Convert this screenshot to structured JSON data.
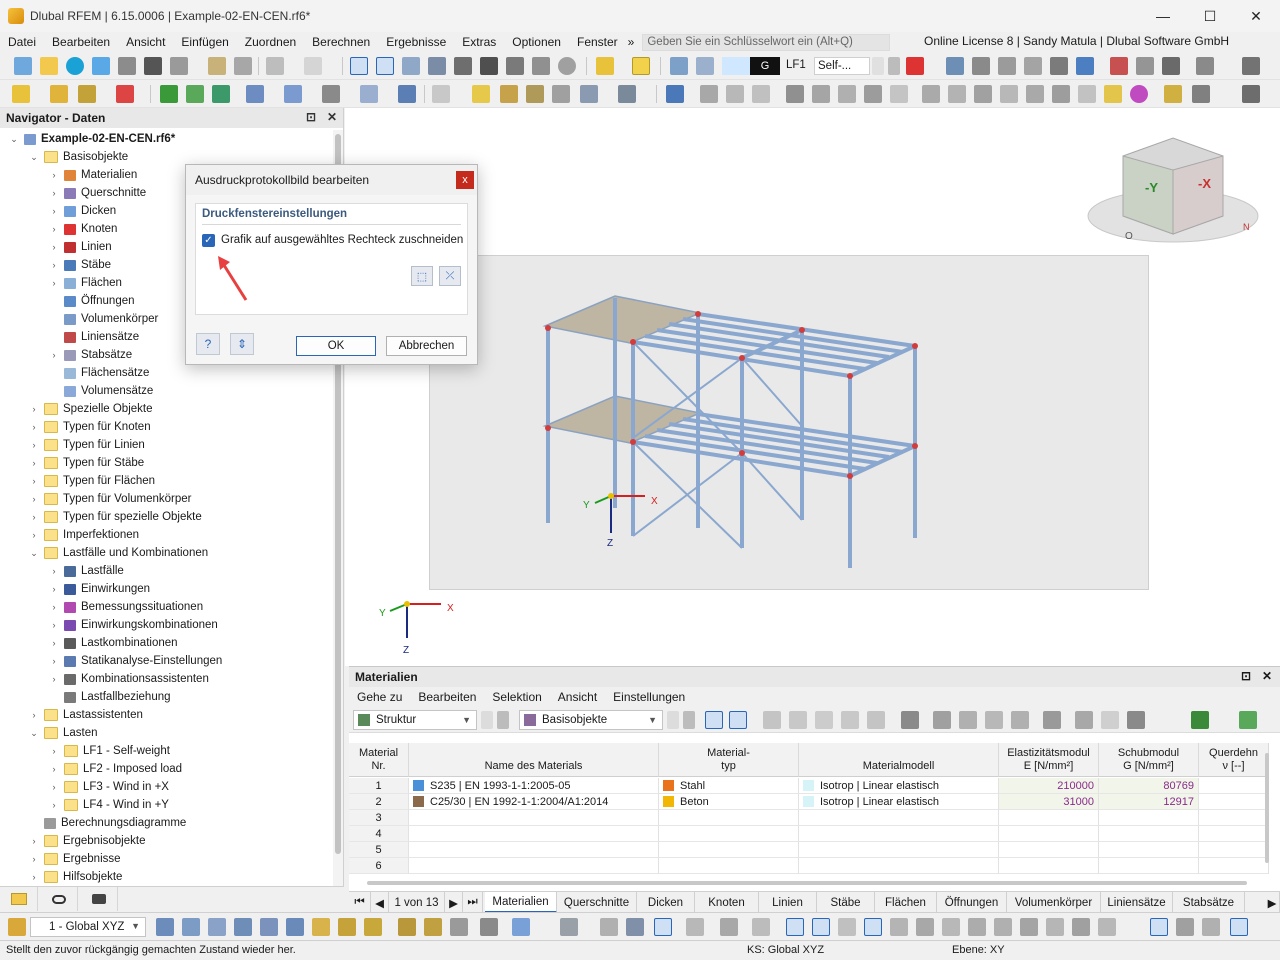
{
  "window": {
    "title": "Dlubal RFEM | 6.15.0006 | Example-02-EN-CEN.rf6*",
    "minimize": "—",
    "maximize": "☐",
    "close": "✕"
  },
  "menu": {
    "items": [
      "Datei",
      "Bearbeiten",
      "Ansicht",
      "Einfügen",
      "Zuordnen",
      "Berechnen",
      "Ergebnisse",
      "Extras",
      "Optionen",
      "Fenster"
    ],
    "overflow": "»",
    "search_placeholder": "Geben Sie ein Schlüsselwort ein (Alt+Q)",
    "license": "Online License 8 | Sandy Matula | Dlubal Software GmbH"
  },
  "toolbar": {
    "load_case_code": "G",
    "load_case": "LF1",
    "load_case_name": "Self-..."
  },
  "navigator": {
    "title": "Navigator - Daten",
    "pin": "⊡",
    "close": "✕",
    "items": [
      {
        "label": "Example-02-EN-CEN.rf6*",
        "level": 0,
        "state": "open",
        "icon": "model-icon"
      },
      {
        "label": "Basisobjekte",
        "level": 1,
        "state": "open",
        "icon": "folder-icon"
      },
      {
        "label": "Materialien",
        "level": 2,
        "state": "closed",
        "icon": "materials-icon"
      },
      {
        "label": "Querschnitte",
        "level": 2,
        "state": "closed",
        "icon": "cross-section-icon"
      },
      {
        "label": "Dicken",
        "level": 2,
        "state": "closed",
        "icon": "thickness-icon"
      },
      {
        "label": "Knoten",
        "level": 2,
        "state": "closed",
        "icon": "node-icon"
      },
      {
        "label": "Linien",
        "level": 2,
        "state": "closed",
        "icon": "line-icon"
      },
      {
        "label": "Stäbe",
        "level": 2,
        "state": "closed",
        "icon": "member-icon"
      },
      {
        "label": "Flächen",
        "level": 2,
        "state": "closed",
        "icon": "surface-icon"
      },
      {
        "label": "Öffnungen",
        "level": 2,
        "state": "none",
        "icon": "opening-icon"
      },
      {
        "label": "Volumenkörper",
        "level": 2,
        "state": "none",
        "icon": "solid-icon"
      },
      {
        "label": "Liniensätze",
        "level": 2,
        "state": "none",
        "icon": "line-set-icon"
      },
      {
        "label": "Stabsätze",
        "level": 2,
        "state": "closed",
        "icon": "member-set-icon"
      },
      {
        "label": "Flächensätze",
        "level": 2,
        "state": "none",
        "icon": "surface-set-icon"
      },
      {
        "label": "Volumensätze",
        "level": 2,
        "state": "none",
        "icon": "solid-set-icon"
      },
      {
        "label": "Spezielle Objekte",
        "level": 1,
        "state": "closed",
        "icon": "folder-icon"
      },
      {
        "label": "Typen für Knoten",
        "level": 1,
        "state": "closed",
        "icon": "folder-icon"
      },
      {
        "label": "Typen für Linien",
        "level": 1,
        "state": "closed",
        "icon": "folder-icon"
      },
      {
        "label": "Typen für Stäbe",
        "level": 1,
        "state": "closed",
        "icon": "folder-icon"
      },
      {
        "label": "Typen für Flächen",
        "level": 1,
        "state": "closed",
        "icon": "folder-icon"
      },
      {
        "label": "Typen für Volumenkörper",
        "level": 1,
        "state": "closed",
        "icon": "folder-icon"
      },
      {
        "label": "Typen für spezielle Objekte",
        "level": 1,
        "state": "closed",
        "icon": "folder-icon"
      },
      {
        "label": "Imperfektionen",
        "level": 1,
        "state": "closed",
        "icon": "folder-icon"
      },
      {
        "label": "Lastfälle und Kombinationen",
        "level": 1,
        "state": "open",
        "icon": "folder-icon"
      },
      {
        "label": "Lastfälle",
        "level": 2,
        "state": "closed",
        "icon": "load-case-icon"
      },
      {
        "label": "Einwirkungen",
        "level": 2,
        "state": "closed",
        "icon": "action-icon"
      },
      {
        "label": "Bemessungssituationen",
        "level": 2,
        "state": "closed",
        "icon": "design-situation-icon"
      },
      {
        "label": "Einwirkungskombinationen",
        "level": 2,
        "state": "closed",
        "icon": "action-combination-icon"
      },
      {
        "label": "Lastkombinationen",
        "level": 2,
        "state": "closed",
        "icon": "load-combination-icon"
      },
      {
        "label": "Statikanalyse-Einstellungen",
        "level": 2,
        "state": "closed",
        "icon": "analysis-settings-icon"
      },
      {
        "label": "Kombinationsassistenten",
        "level": 2,
        "state": "closed",
        "icon": "combination-wizard-icon"
      },
      {
        "label": "Lastfallbeziehung",
        "level": 2,
        "state": "none",
        "icon": "relationship-icon"
      },
      {
        "label": "Lastassistenten",
        "level": 1,
        "state": "closed",
        "icon": "folder-icon"
      },
      {
        "label": "Lasten",
        "level": 1,
        "state": "open",
        "icon": "folder-icon"
      },
      {
        "label": "LF1 - Self-weight",
        "level": 2,
        "state": "closed",
        "icon": "folder-icon"
      },
      {
        "label": "LF2 - Imposed load",
        "level": 2,
        "state": "closed",
        "icon": "folder-icon"
      },
      {
        "label": "LF3 - Wind in +X",
        "level": 2,
        "state": "closed",
        "icon": "folder-icon"
      },
      {
        "label": "LF4 - Wind in +Y",
        "level": 2,
        "state": "closed",
        "icon": "folder-icon"
      },
      {
        "label": "Berechnungsdiagramme",
        "level": 1,
        "state": "none",
        "icon": "diagram-icon"
      },
      {
        "label": "Ergebnisobjekte",
        "level": 1,
        "state": "closed",
        "icon": "folder-icon"
      },
      {
        "label": "Ergebnisse",
        "level": 1,
        "state": "closed",
        "icon": "folder-icon"
      },
      {
        "label": "Hilfsobjekte",
        "level": 1,
        "state": "closed",
        "icon": "folder-icon"
      }
    ]
  },
  "viewport": {
    "axis_x": "X",
    "axis_y": "Y",
    "axis_z": "Z",
    "cube_y": "-Y",
    "cube_x": "-X",
    "compass_n": "N",
    "compass_o": "O"
  },
  "dialog": {
    "title": "Ausdruckprotokollbild bearbeiten",
    "close": "x",
    "group_title": "Druckfenstereinstellungen",
    "checkbox_label": "Grafik auf ausgewähltes Rechteck zuschneiden",
    "checkbox_checked": true,
    "ok": "OK",
    "cancel": "Abbrechen"
  },
  "materials_panel": {
    "title": "Materialien",
    "menu": [
      "Gehe zu",
      "Bearbeiten",
      "Selektion",
      "Ansicht",
      "Einstellungen"
    ],
    "combo_structure": "Struktur",
    "combo_objects": "Basisobjekte",
    "columns": [
      {
        "line1": "Material",
        "line2": "Nr."
      },
      {
        "line1": "",
        "line2": "Name des Materials"
      },
      {
        "line1": "Material-",
        "line2": "typ"
      },
      {
        "line1": "",
        "line2": "Materialmodell"
      },
      {
        "line1": "Elastizitätsmodul",
        "line2": "E [N/mm²]"
      },
      {
        "line1": "Schubmodul",
        "line2": "G [N/mm²]"
      },
      {
        "line1": "Querdehn",
        "line2": "ν [--]"
      }
    ],
    "rows": [
      {
        "nr": "1",
        "name": "S235 | EN 1993-1-1:2005-05",
        "name_color": "#4a90d9",
        "type": "Stahl",
        "type_color": "#e8731c",
        "model": "Isotrop | Linear elastisch",
        "E": "210000",
        "G": "80769"
      },
      {
        "nr": "2",
        "name": "C25/30 | EN 1992-1-1:2004/A1:2014",
        "name_color": "#8a6a4a",
        "type": "Beton",
        "type_color": "#f2b705",
        "model": "Isotrop | Linear elastisch",
        "E": "31000",
        "G": "12917"
      },
      {
        "nr": "3",
        "name": "",
        "type": "",
        "model": "",
        "E": "",
        "G": ""
      },
      {
        "nr": "4",
        "name": "",
        "type": "",
        "model": "",
        "E": "",
        "G": ""
      },
      {
        "nr": "5",
        "name": "",
        "type": "",
        "model": "",
        "E": "",
        "G": ""
      },
      {
        "nr": "6",
        "name": "",
        "type": "",
        "model": "",
        "E": "",
        "G": ""
      }
    ],
    "pager": "1 von 13",
    "tabs": [
      "Materialien",
      "Querschnitte",
      "Dicken",
      "Knoten",
      "Linien",
      "Stäbe",
      "Flächen",
      "Öffnungen",
      "Volumenkörper",
      "Liniensätze",
      "Stabsätze"
    ],
    "active_tab": 0
  },
  "bottom_toolbar": {
    "coord_system": "1 - Global XYZ"
  },
  "statusbar": {
    "message": "Stellt den zuvor rückgängig gemachten Zustand wieder her.",
    "ks": "KS: Global XYZ",
    "plane": "Ebene: XY"
  }
}
